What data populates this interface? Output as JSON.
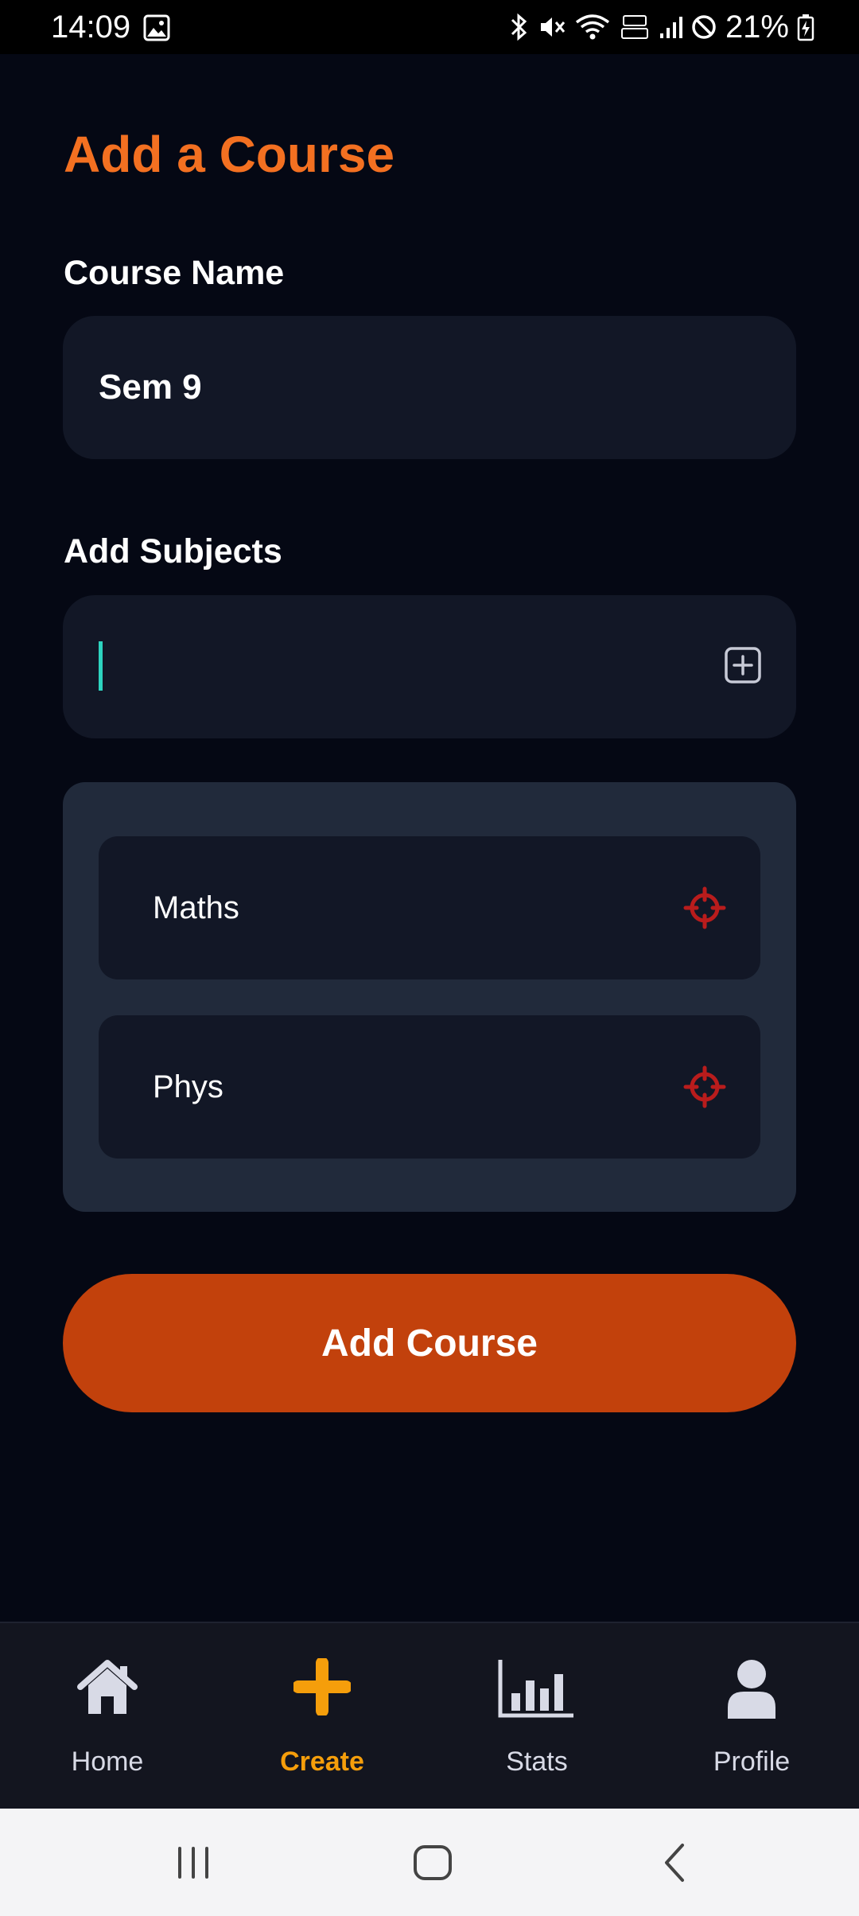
{
  "status_bar": {
    "time": "14:09",
    "battery": "21%",
    "icons": [
      "gallery-icon",
      "bluetooth-icon",
      "mute-icon",
      "wifi-icon",
      "volte-icon",
      "signal-icon",
      "dnd-icon",
      "battery-charging-icon"
    ]
  },
  "page": {
    "title": "Add a Course"
  },
  "course_name": {
    "label": "Course Name",
    "value": "Sem 9"
  },
  "add_subjects": {
    "label": "Add Subjects",
    "value": "",
    "add_icon": "plus-square-icon"
  },
  "subjects": [
    {
      "name": "Maths",
      "icon": "remove-target-icon"
    },
    {
      "name": "Phys",
      "icon": "remove-target-icon"
    }
  ],
  "submit_button": {
    "label": "Add Course"
  },
  "bottom_nav": {
    "items": [
      {
        "label": "Home",
        "icon": "home-icon",
        "active": false
      },
      {
        "label": "Create",
        "icon": "plus-icon",
        "active": true
      },
      {
        "label": "Stats",
        "icon": "bar-chart-icon",
        "active": false
      },
      {
        "label": "Profile",
        "icon": "user-icon",
        "active": false
      }
    ]
  },
  "colors": {
    "background": "#050814",
    "accent_title": "#F37021",
    "button": "#C2410C",
    "active_nav": "#F59E0B",
    "remove_icon": "#B91C1C",
    "cursor": "#2DD4BF"
  }
}
